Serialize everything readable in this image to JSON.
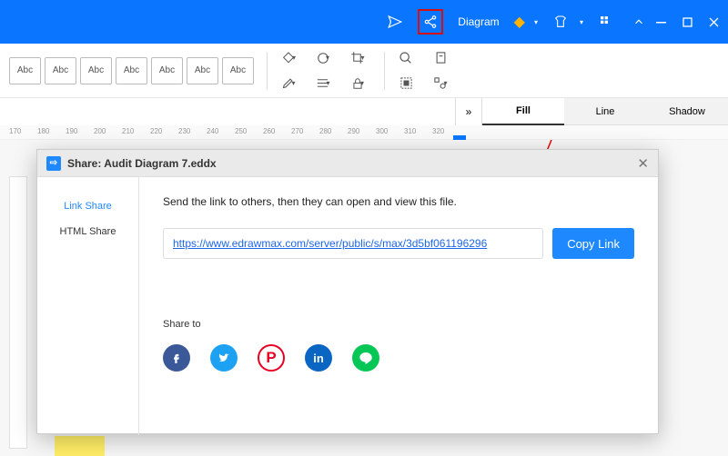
{
  "titlebar": {
    "label": "Diagram"
  },
  "styleboxes": [
    "Abc",
    "Abc",
    "Abc",
    "Abc",
    "Abc",
    "Abc",
    "Abc"
  ],
  "ruler": [
    170,
    180,
    190,
    200,
    210,
    220,
    230,
    240,
    250,
    260,
    270,
    280,
    290,
    300,
    310,
    320
  ],
  "proptabs": {
    "fill": "Fill",
    "line": "Line",
    "shadow": "Shadow"
  },
  "dialog": {
    "title": "Share: Audit Diagram 7.eddx",
    "sidebar": {
      "link": "Link Share",
      "html": "HTML Share"
    },
    "intro": "Send the link to others, then they can open and view this file.",
    "url": "https://www.edrawmax.com/server/public/s/max/3d5bf061196296",
    "copy": "Copy Link",
    "shareto": "Share to"
  }
}
